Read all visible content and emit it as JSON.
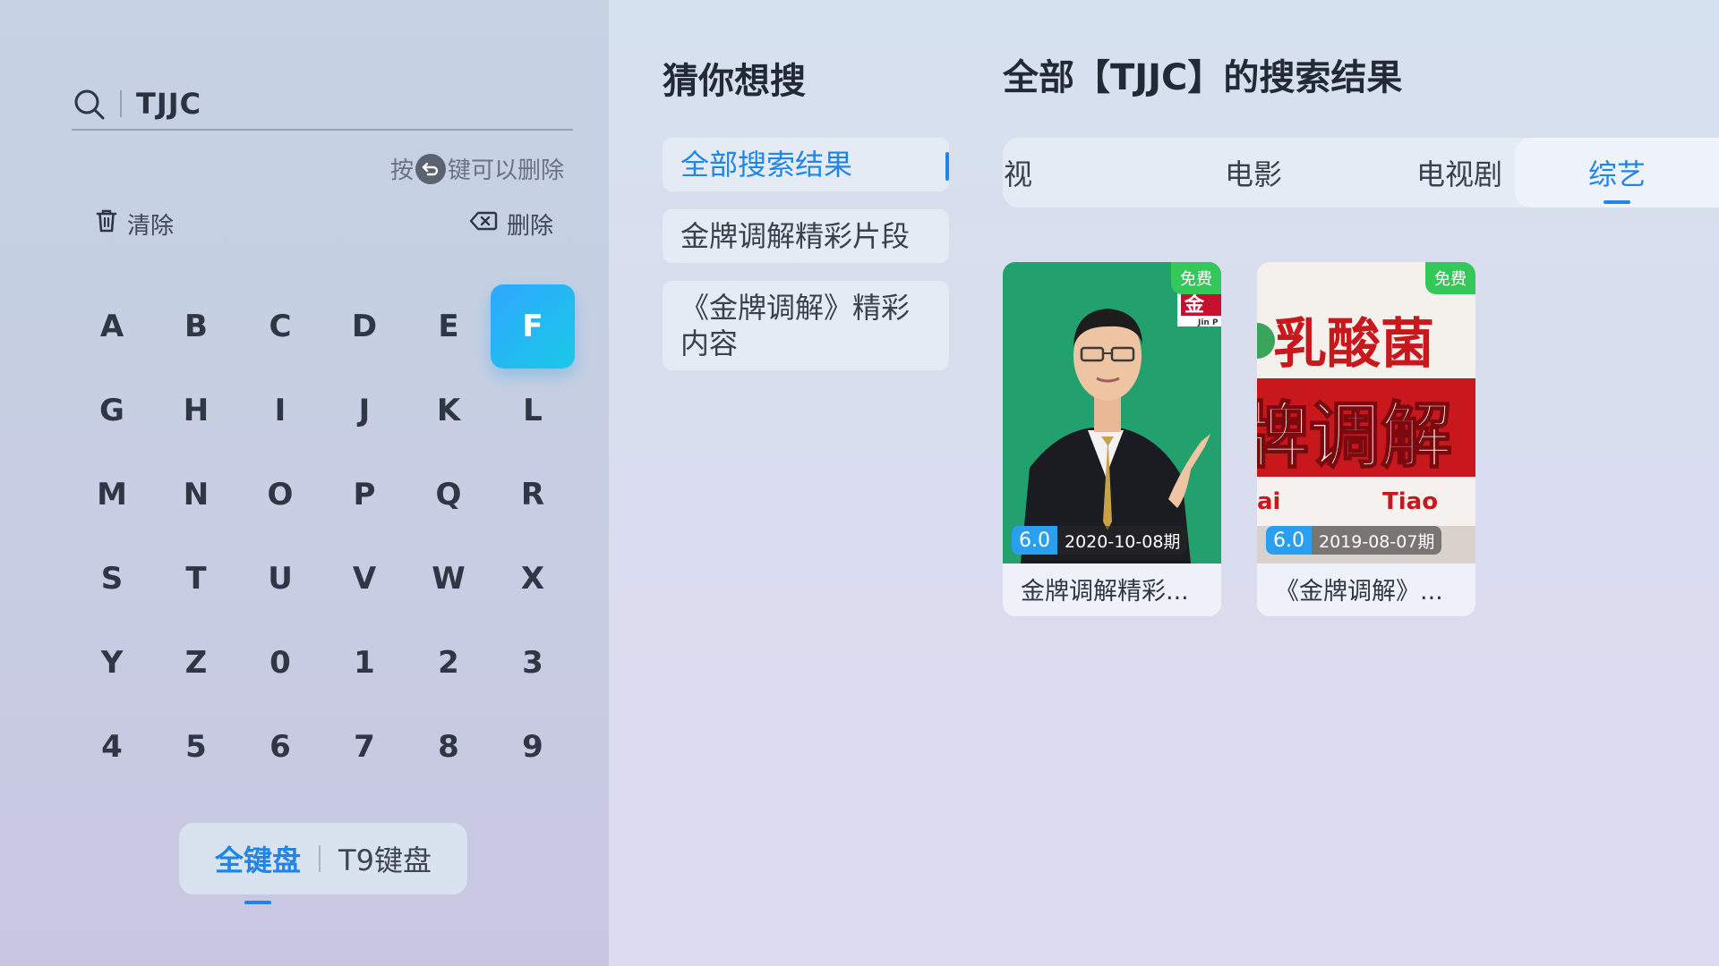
{
  "search": {
    "query": "TJJC",
    "hint_prefix": "按",
    "hint_suffix": "键可以删除",
    "clear_label": "清除",
    "delete_label": "删除"
  },
  "keyboard": {
    "keys": [
      "A",
      "B",
      "C",
      "D",
      "E",
      "F",
      "G",
      "H",
      "I",
      "J",
      "K",
      "L",
      "M",
      "N",
      "O",
      "P",
      "Q",
      "R",
      "S",
      "T",
      "U",
      "V",
      "W",
      "X",
      "Y",
      "Z",
      "0",
      "1",
      "2",
      "3",
      "4",
      "5",
      "6",
      "7",
      "8",
      "9"
    ],
    "focused_key": "F",
    "full_keyboard_label": "全键盘",
    "t9_keyboard_label": "T9键盘",
    "active_mode": "全键盘"
  },
  "guess": {
    "title": "猜你想搜",
    "items": [
      {
        "label": "全部搜索结果",
        "active": true
      },
      {
        "label": "金牌调解精彩片段",
        "active": false
      },
      {
        "label": "《金牌调解》精彩内容",
        "active": false
      }
    ]
  },
  "results": {
    "title": "全部【TJJC】的搜索结果",
    "tabs": [
      {
        "label": "视",
        "active": false
      },
      {
        "label": "电影",
        "active": false
      },
      {
        "label": "电视剧",
        "active": false
      },
      {
        "label": "综艺",
        "active": true
      }
    ],
    "cards": [
      {
        "title": "金牌调解精彩...",
        "score": "6.0",
        "date": "2020-10-08期",
        "badge": "免费",
        "logo_text": "金",
        "logo_sub": "Jin P"
      },
      {
        "title": "《金牌调解》...",
        "score": "6.0",
        "date": "2019-08-07期",
        "badge": "免费",
        "sign_top": "乳酸菌",
        "sign_mid": "牌调解",
        "sign_bottom_left": "ai",
        "sign_bottom_right": "Tiao"
      }
    ]
  },
  "colors": {
    "accent": "#1f86e6",
    "focus_key_gradient_start": "#2fa7ff",
    "focus_key_gradient_end": "#19c9e6",
    "free_badge": "#34c759",
    "score_badge": "#2a9ff0"
  }
}
